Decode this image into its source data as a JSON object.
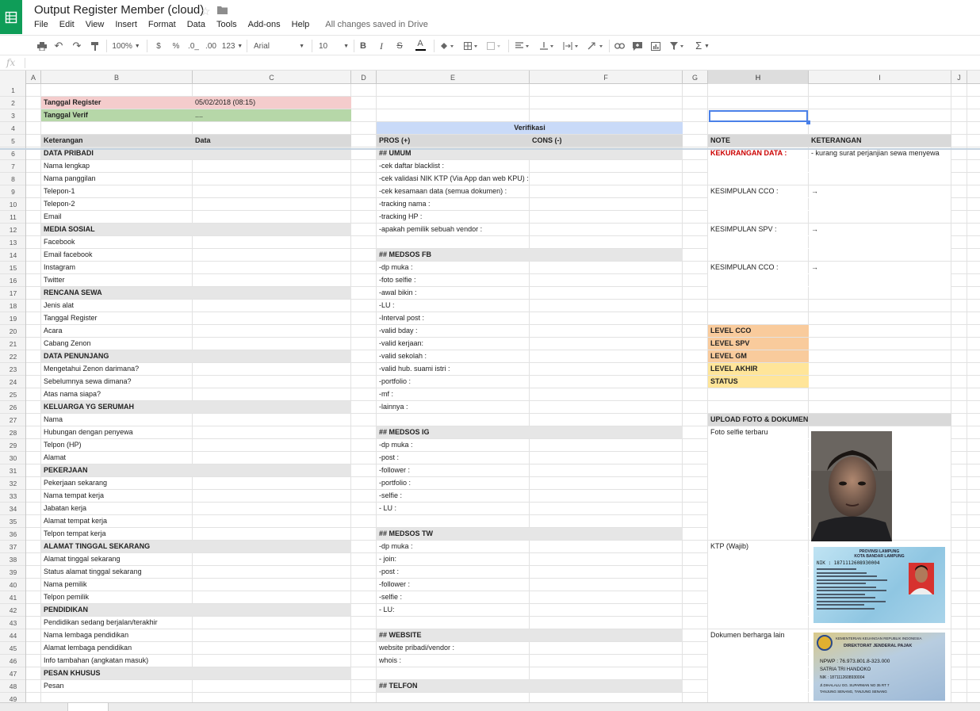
{
  "app": {
    "title": "Output Register Member (cloud)",
    "saved_status": "All changes saved in Drive",
    "menu": [
      "File",
      "Edit",
      "View",
      "Insert",
      "Format",
      "Data",
      "Tools",
      "Add-ons",
      "Help"
    ]
  },
  "toolbar": {
    "zoom": "100%",
    "currency": "$",
    "percent": "%",
    "dec_decrease": ".0_",
    "dec_increase": ".00",
    "more_formats": "123",
    "font": "Arial",
    "font_size": "10",
    "bold": "B",
    "italic": "I",
    "strike": "S",
    "text_color": "A"
  },
  "formula_bar": {
    "fx": "fx"
  },
  "columns": [
    "A",
    "B",
    "C",
    "D",
    "E",
    "F",
    "G",
    "H",
    "I",
    "J"
  ],
  "rows": [
    "1",
    "2",
    "3",
    "4",
    "5",
    "6",
    "7",
    "8",
    "9",
    "10",
    "11",
    "12",
    "13",
    "14",
    "15",
    "16",
    "17",
    "18",
    "19",
    "20",
    "21",
    "22",
    "23",
    "24",
    "25",
    "26",
    "27",
    "28",
    "29",
    "30",
    "31",
    "32",
    "33",
    "34",
    "35",
    "36",
    "37",
    "38",
    "39",
    "40",
    "41",
    "42",
    "43",
    "44",
    "45",
    "46",
    "47",
    "48",
    "49"
  ],
  "register": {
    "tanggal_register_label": "Tanggal Register",
    "tanggal_register_value": "05/02/2018 (08:15)",
    "tanggal_verif_label": "Tanggal Verif",
    "tanggal_verif_value": "....",
    "col_keterangan": "Keterangan",
    "col_data": "Data"
  },
  "left_items": [
    {
      "row": 6,
      "text": "DATA PRIBADI",
      "section": true
    },
    {
      "row": 7,
      "text": "Nama lengkap"
    },
    {
      "row": 8,
      "text": "Nama panggilan"
    },
    {
      "row": 9,
      "text": "Telepon-1"
    },
    {
      "row": 10,
      "text": "Telepon-2"
    },
    {
      "row": 11,
      "text": "Email"
    },
    {
      "row": 12,
      "text": "MEDIA SOSIAL",
      "section": true
    },
    {
      "row": 13,
      "text": "Facebook"
    },
    {
      "row": 14,
      "text": "Email facebook"
    },
    {
      "row": 15,
      "text": "Instagram"
    },
    {
      "row": 16,
      "text": "Twitter"
    },
    {
      "row": 17,
      "text": "RENCANA SEWA",
      "section": true
    },
    {
      "row": 18,
      "text": "Jenis alat"
    },
    {
      "row": 19,
      "text": "Tanggal Register"
    },
    {
      "row": 20,
      "text": "Acara"
    },
    {
      "row": 21,
      "text": "Cabang Zenon"
    },
    {
      "row": 22,
      "text": "DATA PENUNJANG",
      "section": true
    },
    {
      "row": 23,
      "text": "Mengetahui Zenon darimana?"
    },
    {
      "row": 24,
      "text": "Sebelumnya sewa dimana?"
    },
    {
      "row": 25,
      "text": "Atas nama siapa?"
    },
    {
      "row": 26,
      "text": "KELUARGA YG SERUMAH",
      "section": true
    },
    {
      "row": 27,
      "text": "Nama"
    },
    {
      "row": 28,
      "text": "Hubungan dengan penyewa"
    },
    {
      "row": 29,
      "text": "Telpon (HP)"
    },
    {
      "row": 30,
      "text": "Alamat"
    },
    {
      "row": 31,
      "text": "PEKERJAAN",
      "section": true
    },
    {
      "row": 32,
      "text": "Pekerjaan sekarang"
    },
    {
      "row": 33,
      "text": "Nama tempat kerja"
    },
    {
      "row": 34,
      "text": "Jabatan kerja"
    },
    {
      "row": 35,
      "text": "Alamat tempat kerja"
    },
    {
      "row": 36,
      "text": "Telpon tempat kerja"
    },
    {
      "row": 37,
      "text": "ALAMAT TINGGAL SEKARANG",
      "section": true
    },
    {
      "row": 38,
      "text": "Alamat tinggal sekarang"
    },
    {
      "row": 39,
      "text": "Status alamat tinggal sekarang"
    },
    {
      "row": 40,
      "text": "Nama pemilik"
    },
    {
      "row": 41,
      "text": "Telpon pemilik"
    },
    {
      "row": 42,
      "text": "PENDIDIKAN",
      "section": true
    },
    {
      "row": 43,
      "text": "Pendidikan sedang berjalan/terakhir"
    },
    {
      "row": 44,
      "text": "Nama lembaga pendidikan"
    },
    {
      "row": 45,
      "text": "Alamat lembaga pendidikan"
    },
    {
      "row": 46,
      "text": "Info tambahan (angkatan masuk)"
    },
    {
      "row": 47,
      "text": "PESAN KHUSUS",
      "section": true
    },
    {
      "row": 48,
      "text": "Pesan"
    }
  ],
  "verifikasi": {
    "title": "Verifikasi",
    "pros": "PROS (+)",
    "cons": "CONS (-)",
    "items": [
      {
        "row": 6,
        "text": "## UMUM",
        "section": true
      },
      {
        "row": 7,
        "text": "-cek daftar blacklist :"
      },
      {
        "row": 8,
        "text": "-cek validasi NIK KTP (Via App dan web KPU) :"
      },
      {
        "row": 9,
        "text": "-cek kesamaan data (semua dokumen) :"
      },
      {
        "row": 10,
        "text": "-tracking nama :"
      },
      {
        "row": 11,
        "text": "-tracking HP :"
      },
      {
        "row": 12,
        "text": "-apakah pemilik sebuah vendor :"
      },
      {
        "row": 14,
        "text": "## MEDSOS FB",
        "section": true
      },
      {
        "row": 15,
        "text": "-dp muka :"
      },
      {
        "row": 16,
        "text": "-foto selfie :"
      },
      {
        "row": 17,
        "text": "-awal bikin :"
      },
      {
        "row": 18,
        "text": "-LU :"
      },
      {
        "row": 19,
        "text": "-Interval post :"
      },
      {
        "row": 20,
        "text": "-valid bday :"
      },
      {
        "row": 21,
        "text": "-valid kerjaan:"
      },
      {
        "row": 22,
        "text": "-valid sekolah :"
      },
      {
        "row": 23,
        "text": "-valid hub. suami istri :"
      },
      {
        "row": 24,
        "text": "-portfolio :"
      },
      {
        "row": 25,
        "text": "-mf :"
      },
      {
        "row": 26,
        "text": "-lainnya :"
      },
      {
        "row": 28,
        "text": "## MEDSOS IG",
        "section": true
      },
      {
        "row": 29,
        "text": "-dp muka :"
      },
      {
        "row": 30,
        "text": "-post :"
      },
      {
        "row": 31,
        "text": "-follower :"
      },
      {
        "row": 32,
        "text": "-portfolio :"
      },
      {
        "row": 33,
        "text": "-selfie :"
      },
      {
        "row": 34,
        "text": "- LU :"
      },
      {
        "row": 36,
        "text": "## MEDSOS TW",
        "section": true
      },
      {
        "row": 37,
        "text": "-dp muka :"
      },
      {
        "row": 38,
        "text": "- join:"
      },
      {
        "row": 39,
        "text": "-post :"
      },
      {
        "row": 40,
        "text": "-follower :"
      },
      {
        "row": 41,
        "text": "-selfie :"
      },
      {
        "row": 42,
        "text": "- LU:"
      },
      {
        "row": 44,
        "text": "## WEBSITE",
        "section": true
      },
      {
        "row": 45,
        "text": "website pribadi/vendor :"
      },
      {
        "row": 46,
        "text": "whois :"
      },
      {
        "row": 48,
        "text": "## TELFON",
        "section": true
      }
    ]
  },
  "notes": {
    "col_note": "NOTE",
    "col_keterangan": "KETERANGAN",
    "kekurangan_label": "KEKURANGAN DATA :",
    "kekurangan_value": "- kurang surat perjanjian sewa menyewa",
    "kesimpulan_cco_1": "KESIMPULAN CCO :",
    "kesimpulan_spv": "KESIMPULAN SPV :",
    "kesimpulan_cco_2": "KESIMPULAN CCO :",
    "arrow": "→"
  },
  "levels": [
    {
      "label": "LEVEL CCO",
      "color": "#f9cb9c"
    },
    {
      "label": "LEVEL SPV",
      "color": "#f9cb9c"
    },
    {
      "label": "LEVEL GM",
      "color": "#f9cb9c"
    },
    {
      "label": "LEVEL AKHIR",
      "color": "#ffe599"
    },
    {
      "label": "STATUS",
      "color": "#ffe599"
    }
  ],
  "uploads": {
    "title": "UPLOAD FOTO & DOKUMEN",
    "selfie_label": "Foto selfie terbaru",
    "ktp_label": "KTP (Wajib)",
    "dokumen_label": "Dokumen berharga lain",
    "ktp_text": {
      "province": "PROVINSI LAMPUNG",
      "city": "KOTA BANDAR LAMPUNG",
      "nik": "NIK : 1871112608930004"
    },
    "npwp_text": {
      "ministry": "KEMENTERIAN KEUANGAN REPUBLIK INDONESIA",
      "directorate": "DIREKTORAT JENDERAL PAJAK",
      "npwp": "NPWP : 76.973.801.8-323.000",
      "name": "SATRIA TRI HANDOKO",
      "nik": "NIK : 1871112608930004",
      "addr1": "Jl.DIHALALU GG. SUPARMAN NO 35 RT 7",
      "addr2": "TANJUNG SENANG, TANJUNG SENANG"
    }
  },
  "colors": {
    "brand": "#0f9d58",
    "selection": "#4a80e8"
  }
}
